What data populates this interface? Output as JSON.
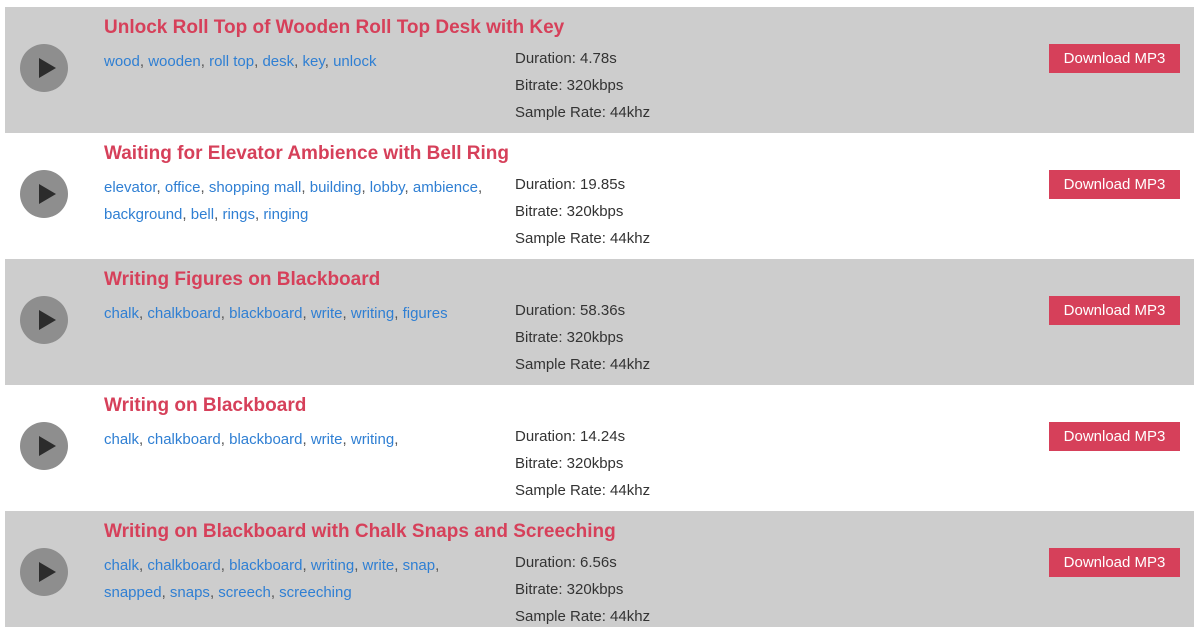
{
  "download_label": "Download MP3",
  "sounds": [
    {
      "title": "Unlock Roll Top of Wooden Roll Top Desk with Key",
      "tags": [
        "wood",
        "wooden",
        "roll top",
        "desk",
        "key",
        "unlock"
      ],
      "trailing_comma": false,
      "duration": "Duration: 4.78s",
      "bitrate": "Bitrate: 320kbps",
      "sample_rate": "Sample Rate: 44khz"
    },
    {
      "title": "Waiting for Elevator Ambience with Bell Ring",
      "tags": [
        "elevator",
        "office",
        "shopping mall",
        "building",
        "lobby",
        "ambience",
        "background",
        "bell",
        "rings",
        "ringing"
      ],
      "trailing_comma": false,
      "duration": "Duration: 19.85s",
      "bitrate": "Bitrate: 320kbps",
      "sample_rate": "Sample Rate: 44khz"
    },
    {
      "title": "Writing Figures on Blackboard",
      "tags": [
        "chalk",
        "chalkboard",
        "blackboard",
        "write",
        "writing",
        "figures"
      ],
      "trailing_comma": false,
      "duration": "Duration: 58.36s",
      "bitrate": "Bitrate: 320kbps",
      "sample_rate": "Sample Rate: 44khz"
    },
    {
      "title": "Writing on Blackboard",
      "tags": [
        "chalk",
        "chalkboard",
        "blackboard",
        "write",
        "writing"
      ],
      "trailing_comma": true,
      "duration": "Duration: 14.24s",
      "bitrate": "Bitrate: 320kbps",
      "sample_rate": "Sample Rate: 44khz"
    },
    {
      "title": "Writing on Blackboard with Chalk Snaps and Screeching",
      "tags": [
        "chalk",
        "chalkboard",
        "blackboard",
        "writing",
        "write",
        "snap",
        "snapped",
        "snaps",
        "screech",
        "screeching"
      ],
      "trailing_comma": false,
      "duration": "Duration: 6.56s",
      "bitrate": "Bitrate: 320kbps",
      "sample_rate": "Sample Rate: 44khz"
    }
  ]
}
